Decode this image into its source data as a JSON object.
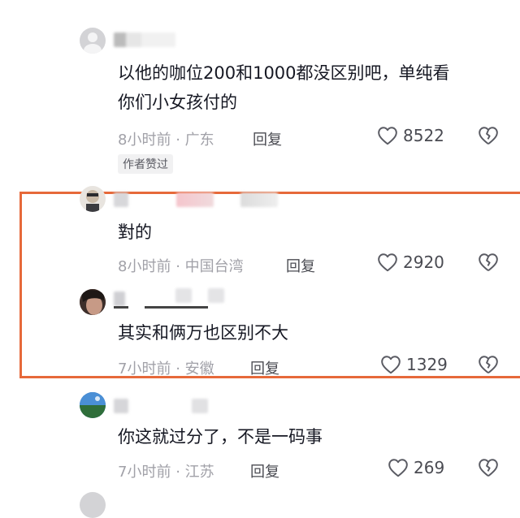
{
  "comments": [
    {
      "text_lines": [
        "以他的咖位200和1000都没区别吧，单纯看",
        "你们小女孩付的"
      ],
      "time": "8小时前",
      "location": "广东",
      "reply_label": "回复",
      "likes": "8522",
      "badge": "作者赞过"
    },
    {
      "text_lines": [
        "對的"
      ],
      "time": "8小时前",
      "location": "中国台湾",
      "reply_label": "回复",
      "likes": "2920"
    },
    {
      "text_lines": [
        "其实和俩万也区别不大"
      ],
      "time": "7小时前",
      "location": "安徽",
      "reply_label": "回复",
      "likes": "1329"
    },
    {
      "text_lines": [
        "你这就过分了，不是一码事"
      ],
      "time": "7小时前",
      "location": "江苏",
      "reply_label": "回复",
      "likes": "269"
    }
  ],
  "meta_separator": "·",
  "icons": {
    "like": "heart-outline-icon",
    "dislike": "broken-heart-icon"
  },
  "colors": {
    "highlight_border": "#e6693a",
    "meta_text": "#a1a1a8",
    "body_text": "#161823"
  }
}
